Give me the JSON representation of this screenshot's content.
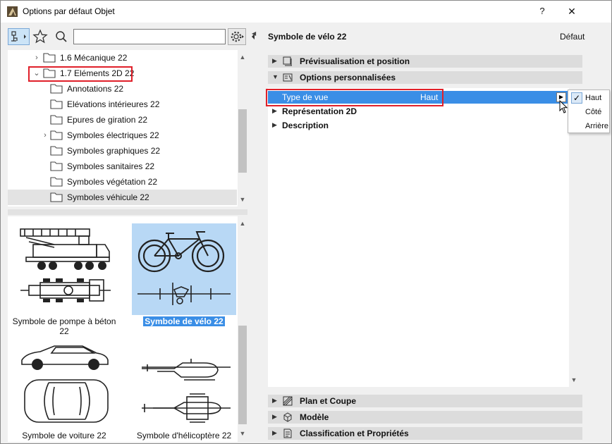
{
  "window": {
    "title": "Options par défaut Objet",
    "help_label": "?",
    "close_label": "✕"
  },
  "toolbar": {
    "search_value": "",
    "search_placeholder": ""
  },
  "tree": {
    "items": [
      {
        "label": "1.6 Mécanique 22",
        "expander": "›"
      },
      {
        "label": "1.7 Eléments 2D 22",
        "expander": "⌄"
      },
      {
        "label": "Annotations 22",
        "expander": ""
      },
      {
        "label": "Elévations intérieures 22",
        "expander": ""
      },
      {
        "label": "Epures de giration 22",
        "expander": ""
      },
      {
        "label": "Symboles électriques 22",
        "expander": "›"
      },
      {
        "label": "Symboles graphiques 22",
        "expander": ""
      },
      {
        "label": "Symboles sanitaires 22",
        "expander": ""
      },
      {
        "label": "Symboles végétation 22",
        "expander": ""
      },
      {
        "label": "Symboles véhicule 22",
        "expander": ""
      }
    ]
  },
  "thumbnails": [
    {
      "caption": "Symbole de pompe à béton 22",
      "selected": false
    },
    {
      "caption": "Symbole de vélo 22",
      "selected": true
    },
    {
      "caption": "Symbole de voiture 22",
      "selected": false
    },
    {
      "caption": "Symbole d'hélicoptère 22",
      "selected": false
    }
  ],
  "object": {
    "name": "Symbole de vélo 22",
    "default_label": "Défaut"
  },
  "sections_top": [
    {
      "label": "Prévisualisation et position",
      "icon": "preview-icon",
      "expander": "▶"
    },
    {
      "label": "Options personnalisées",
      "icon": "custom-options-icon",
      "expander": "▼"
    }
  ],
  "params": [
    {
      "label": "Type de vue",
      "value": "Haut",
      "selected": true,
      "expander": ""
    },
    {
      "label": "Représentation 2D",
      "value": "",
      "selected": false,
      "expander": "▶"
    },
    {
      "label": "Description",
      "value": "",
      "selected": false,
      "expander": "▶"
    }
  ],
  "sections_bottom": [
    {
      "label": "Plan et Coupe",
      "icon": "plan-section-icon",
      "expander": "▶"
    },
    {
      "label": "Modèle",
      "icon": "model-icon",
      "expander": "▶"
    },
    {
      "label": "Classification et Propriétés",
      "icon": "classification-icon",
      "expander": "▶"
    }
  ],
  "dropdown": {
    "options": [
      {
        "label": "Haut",
        "checked": true
      },
      {
        "label": "Côté",
        "checked": false
      },
      {
        "label": "Arrière",
        "checked": false
      }
    ]
  },
  "colors": {
    "accent": "#3a8ee6",
    "highlight": "#e0202a",
    "selection_bg": "#b8d8f5"
  }
}
